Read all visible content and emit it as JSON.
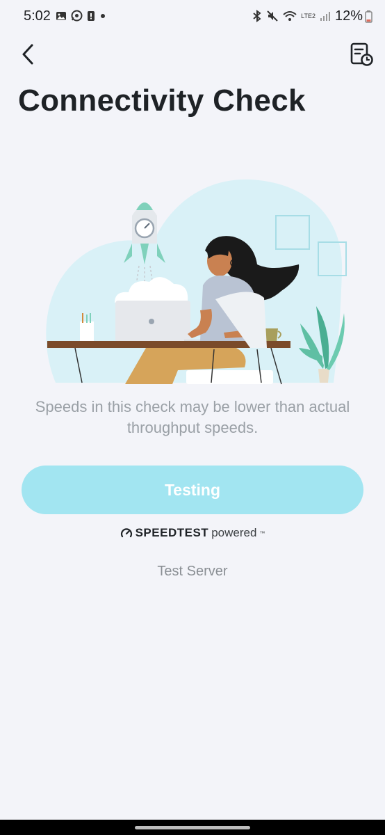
{
  "status_bar": {
    "time": "5:02",
    "battery": "12%",
    "network": "LTE2"
  },
  "header": {
    "back_icon": "chevron-left-icon",
    "history_icon": "report-clock-icon"
  },
  "title": "Connectivity Check",
  "note": "Speeds in this check may be lower than actual throughput speeds.",
  "test_button_label": "Testing",
  "speedtest": {
    "brand": "SPEEDTEST",
    "suffix": "powered"
  },
  "server_label": "Test Server",
  "colors": {
    "background": "#f3f4f9",
    "button": "#a2e5f1",
    "title": "#1e2226"
  }
}
